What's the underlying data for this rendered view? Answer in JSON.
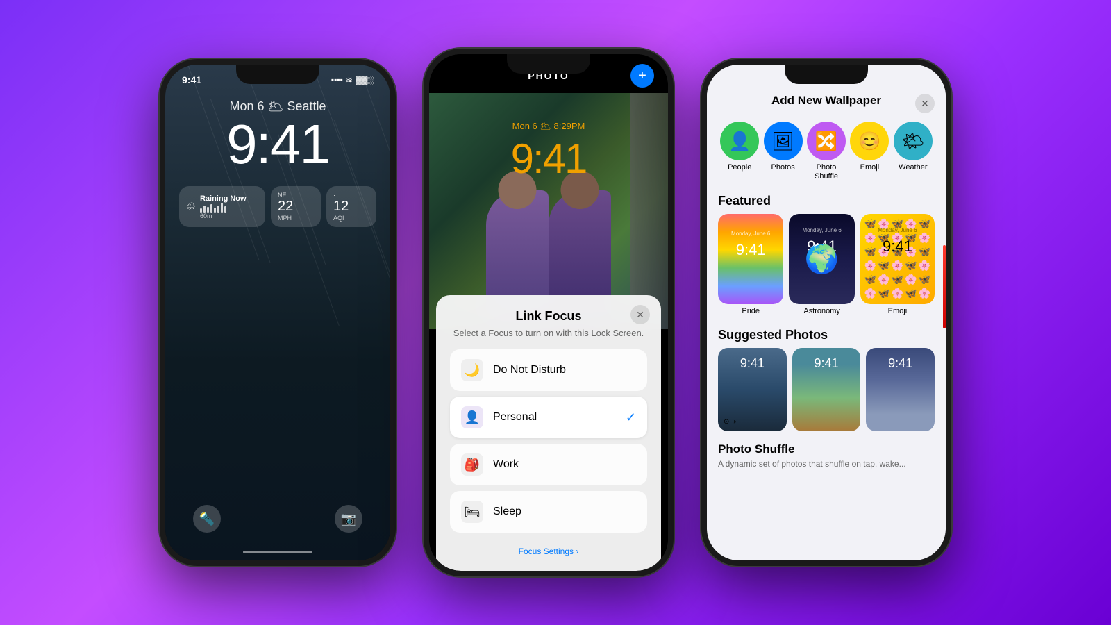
{
  "background": {
    "gradient": "purple"
  },
  "phone1": {
    "date": "Mon 6",
    "city": "Seattle",
    "weather_icon": "🌥",
    "time": "9:41",
    "widget1_label": "Raining Now",
    "widget1_icon": "🌧",
    "widget2_ne": "NE",
    "widget2_value": "22",
    "widget2_unit": "MPH",
    "widget2_label": "60m",
    "widget3_value": "12",
    "widget3_unit": "AQI",
    "flashlight_icon": "🔦",
    "camera_icon": "📷"
  },
  "phone2": {
    "photo_label": "PHOTO",
    "plus_btn": "+",
    "overlay_date": "Mon 6  🌥  8:29PM",
    "overlay_time": "9:41",
    "link_focus": {
      "title": "Link Focus",
      "subtitle": "Select a Focus to turn on with this Lock Screen.",
      "items": [
        {
          "id": "do-not-disturb",
          "icon": "🌙",
          "label": "Do Not Disturb",
          "selected": false
        },
        {
          "id": "personal",
          "icon": "👤",
          "label": "Personal",
          "selected": true
        },
        {
          "id": "work",
          "icon": "🎒",
          "label": "Work",
          "selected": false
        },
        {
          "id": "sleep",
          "icon": "🛏",
          "label": "Sleep",
          "selected": false
        }
      ],
      "footer": "Focus Settings ›"
    }
  },
  "phone3": {
    "title": "Add New Wallpaper",
    "close": "✕",
    "icon_items": [
      {
        "id": "people",
        "icon": "👤",
        "color": "#34c759",
        "label": "People"
      },
      {
        "id": "photos",
        "icon": "🖼",
        "color": "#007aff",
        "label": "Photos"
      },
      {
        "id": "photo-shuffle",
        "icon": "🔀",
        "color": "#bf5af2",
        "label": "Photo Shuffle"
      },
      {
        "id": "emoji",
        "icon": "😊",
        "color": "#ffd60a",
        "label": "Emoji"
      },
      {
        "id": "weather",
        "icon": "🌤",
        "color": "#30b0c7",
        "label": "Weather"
      }
    ],
    "featured_label": "Featured",
    "featured": [
      {
        "id": "pride",
        "label": "Pride"
      },
      {
        "id": "astronomy",
        "label": "Astronomy"
      },
      {
        "id": "emoji",
        "label": "Emoji"
      }
    ],
    "suggested_label": "Suggested Photos",
    "suggested": [
      {
        "id": "bridge",
        "label": ""
      },
      {
        "id": "tree",
        "label": ""
      },
      {
        "id": "city",
        "label": ""
      }
    ],
    "photo_shuffle_label": "Photo Shuffle",
    "photo_shuffle_desc": "A dynamic set of photos that shuffle on tap, wake...",
    "time_on_thumbs": "9:41"
  }
}
